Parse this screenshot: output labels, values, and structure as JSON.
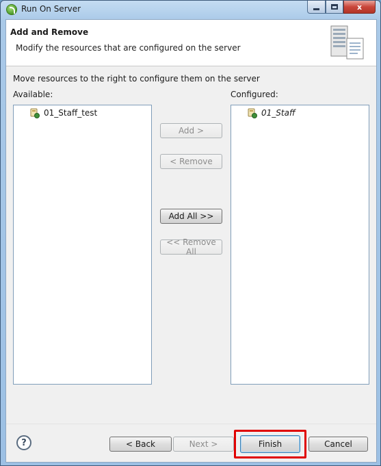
{
  "window": {
    "title": "Run On Server",
    "close_label": "x"
  },
  "header": {
    "title": "Add and Remove",
    "description": "Modify the resources that are configured on the server"
  },
  "body": {
    "instruction": "Move resources to the right to configure them on the server",
    "available_label": "Available:",
    "configured_label": "Configured:",
    "available_items": [
      "01_Staff_test"
    ],
    "configured_items": [
      "01_Staff"
    ]
  },
  "actions": {
    "add": "Add >",
    "remove": "< Remove",
    "add_all": "Add All >>",
    "remove_all": "<< Remove All"
  },
  "footer": {
    "help": "?",
    "back": "< Back",
    "next": "Next >",
    "finish": "Finish",
    "cancel": "Cancel"
  },
  "colors": {
    "highlight": "#e00000",
    "title_bar": "#a9c9e8"
  }
}
